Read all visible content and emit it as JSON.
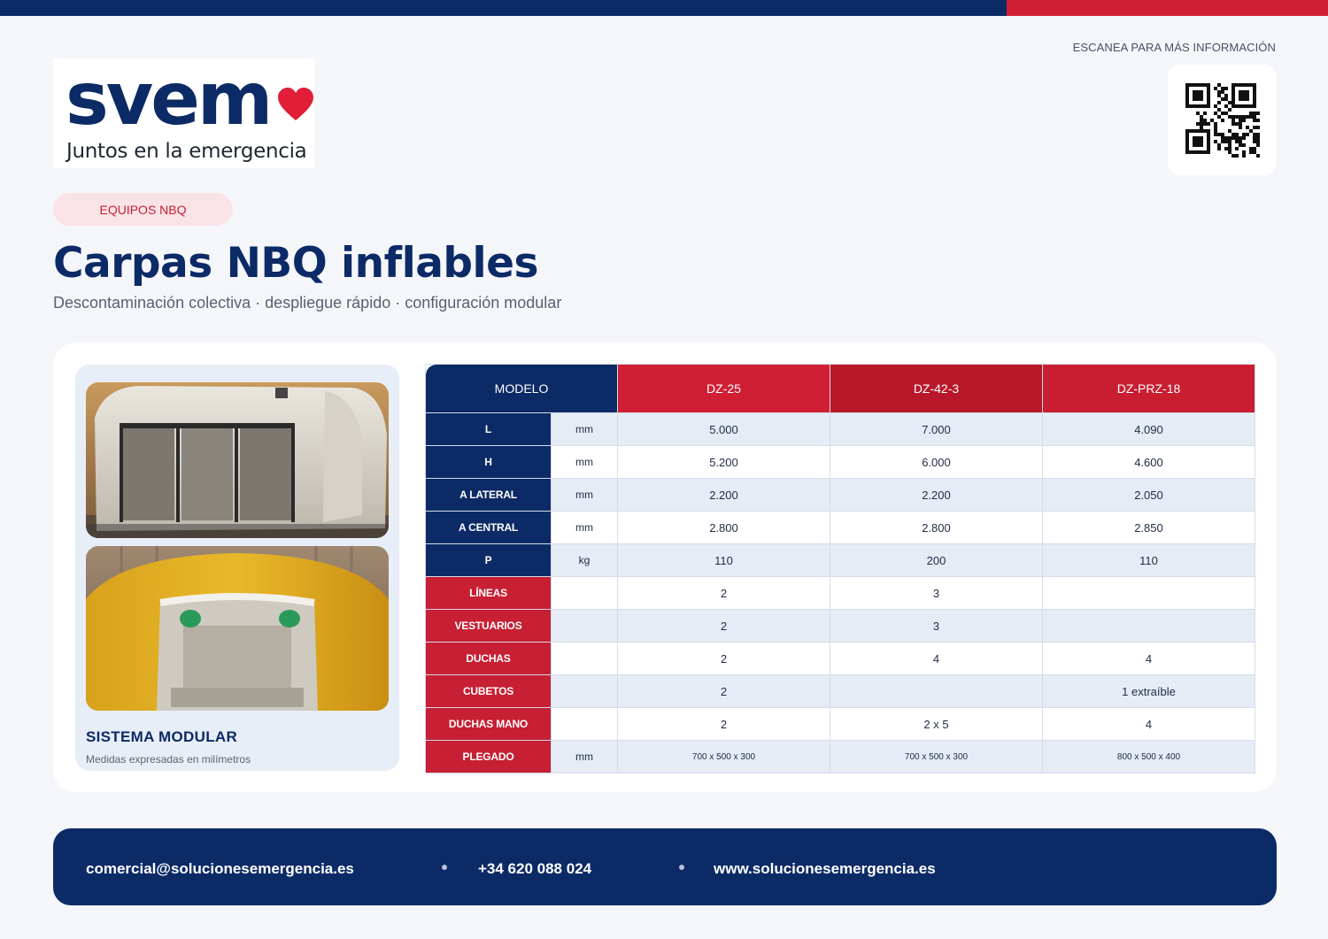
{
  "colors": {
    "navy": "#0c2a66",
    "red": "#d01f35",
    "pill_bg": "#fae3e7",
    "background": "#f4f6fa"
  },
  "brand": {
    "wordmark": "svem",
    "slogan": "Juntos en la emergencia",
    "logo_icon": "heart-icon"
  },
  "qr": {
    "caption": "ESCANEA PARA MÁS INFORMACIÓN",
    "icon": "qr-code-icon"
  },
  "category_label": "EQUIPOS NBQ",
  "title": "Carpas NBQ inflables",
  "subtitle": "Descontaminación colectiva · despliegue rápido · configuración modular",
  "panel": {
    "title": "SISTEMA MODULAR",
    "note": "Medidas expresadas en milímetros"
  },
  "spec_table": {
    "model_header": "MODELO",
    "models": [
      "DZ-25",
      "DZ-42-3",
      "DZ-PRZ-18"
    ],
    "rows": [
      {
        "label": "L",
        "unit": "mm",
        "values": [
          "5.000",
          "7.000",
          "4.090"
        ],
        "group": "dimension"
      },
      {
        "label": "H",
        "unit": "mm",
        "values": [
          "5.200",
          "6.000",
          "4.600"
        ],
        "group": "dimension"
      },
      {
        "label": "A LATERAL",
        "unit": "mm",
        "values": [
          "2.200",
          "2.200",
          "2.050"
        ],
        "group": "dimension"
      },
      {
        "label": "A CENTRAL",
        "unit": "mm",
        "values": [
          "2.800",
          "2.800",
          "2.850"
        ],
        "group": "dimension"
      },
      {
        "label": "P",
        "unit": "kg",
        "values": [
          "110",
          "200",
          "110"
        ],
        "group": "dimension"
      },
      {
        "label": "LÍNEAS",
        "unit": "",
        "values": [
          "2",
          "3",
          ""
        ],
        "group": "feature"
      },
      {
        "label": "VESTUARIOS",
        "unit": "",
        "values": [
          "2",
          "3",
          ""
        ],
        "group": "feature"
      },
      {
        "label": "DUCHAS",
        "unit": "",
        "values": [
          "2",
          "4",
          "4"
        ],
        "group": "feature"
      },
      {
        "label": "CUBETOS",
        "unit": "",
        "values": [
          "2",
          "",
          "1 extraíble"
        ],
        "group": "feature"
      },
      {
        "label": "DUCHAS MANO",
        "unit": "",
        "values": [
          "2",
          "2 x 5",
          "4"
        ],
        "group": "feature"
      },
      {
        "label": "PLEGADO",
        "unit": "mm",
        "values": [
          "700 x 500 x 300",
          "700 x 500 x 300",
          "800 x 500 x 400"
        ],
        "group": "feature"
      }
    ]
  },
  "footer": {
    "email": "comercial@solucionesemergencia.es",
    "phone": "+34 620 088 024",
    "website": "www.solucionesemergencia.es"
  }
}
